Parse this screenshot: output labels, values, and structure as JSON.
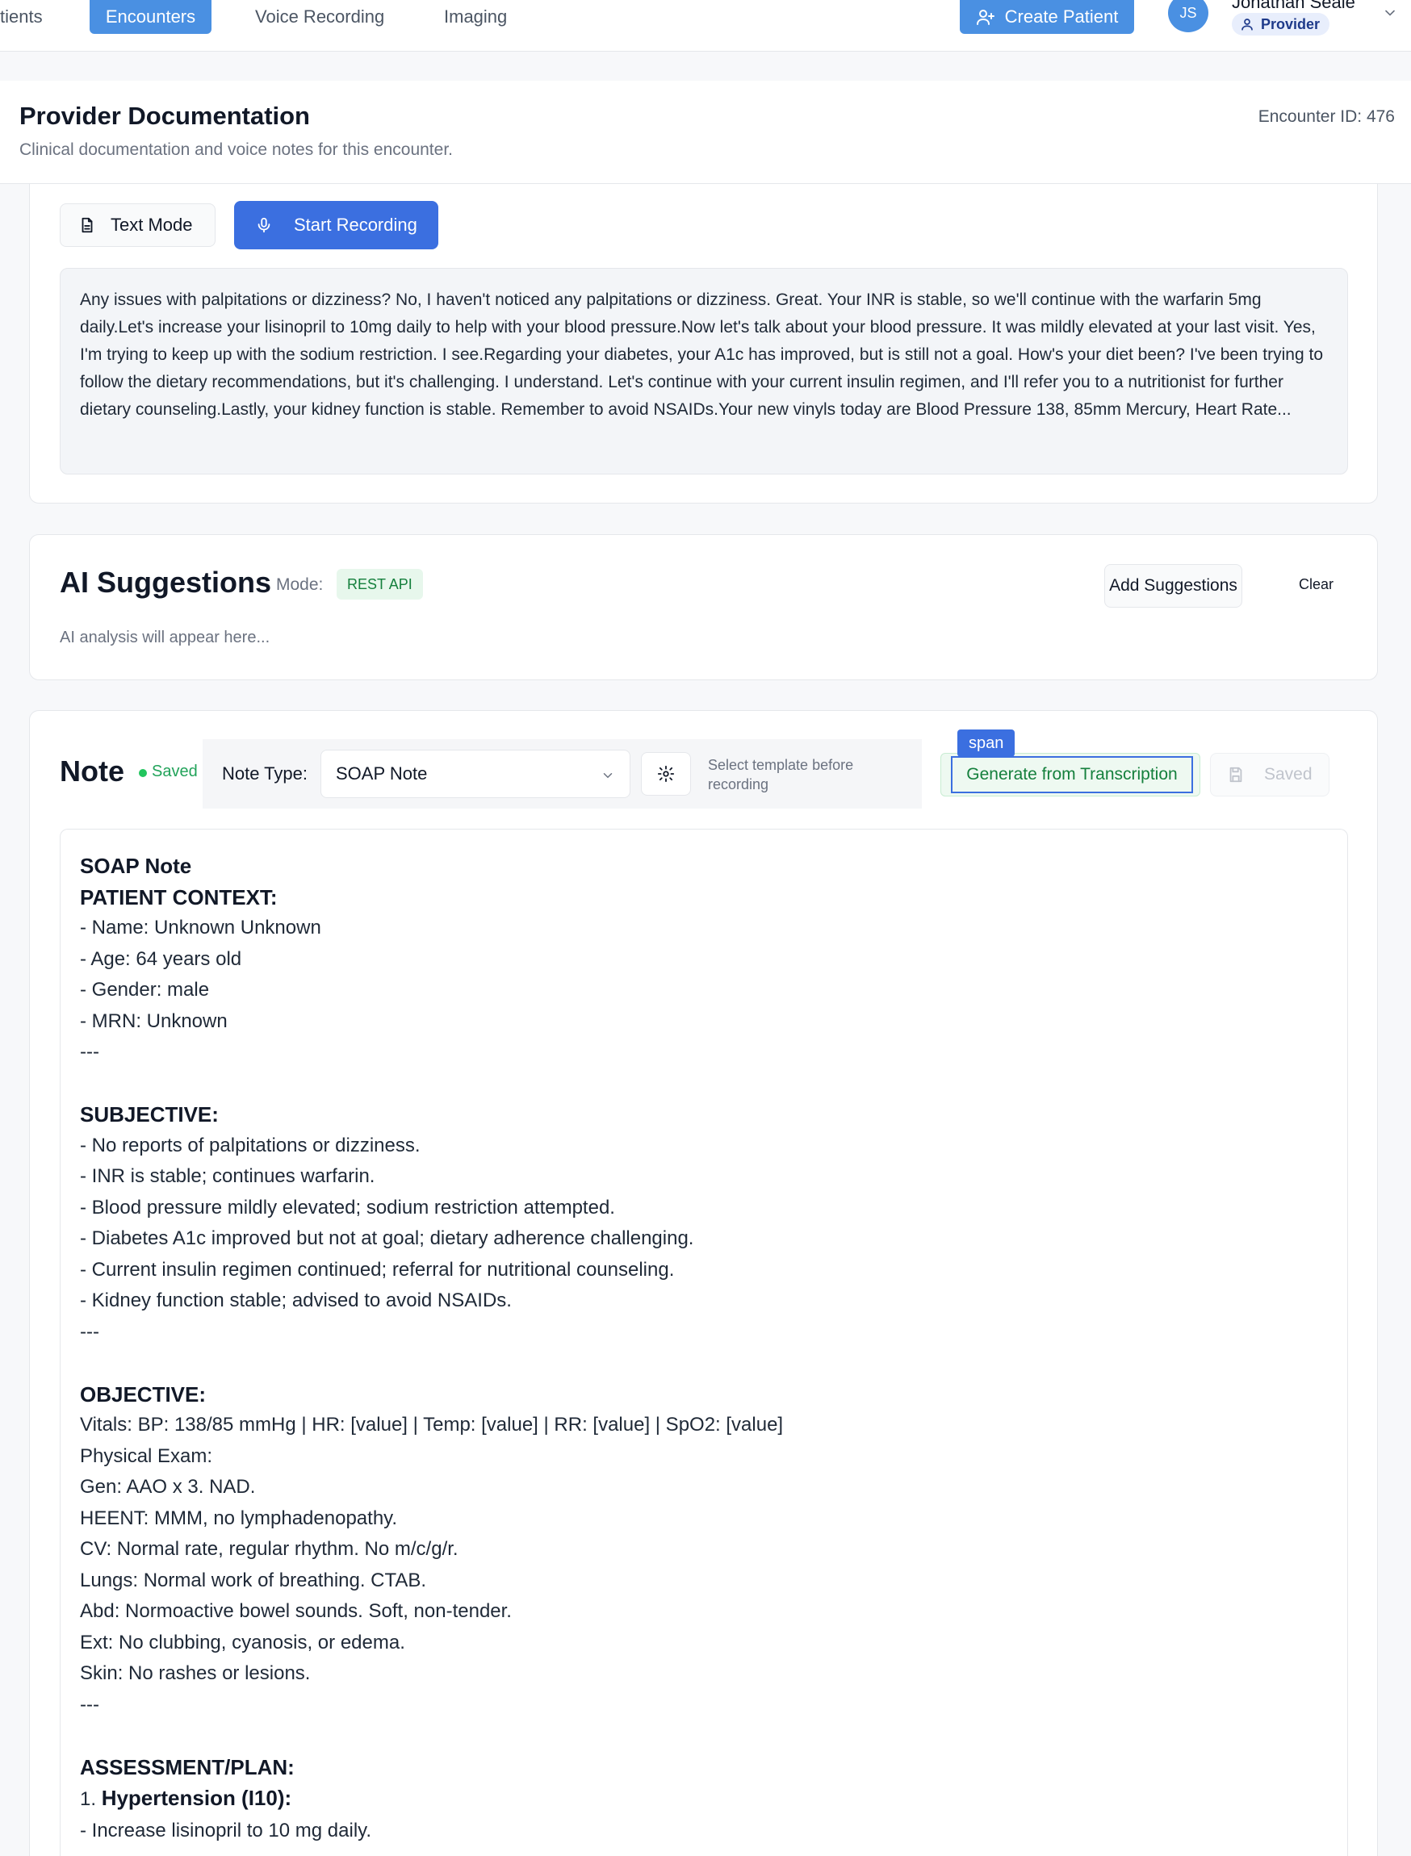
{
  "nav": {
    "tabs": [
      {
        "label": "tients",
        "active": false
      },
      {
        "label": "Encounters",
        "active": true
      },
      {
        "label": "Voice Recording",
        "active": false
      },
      {
        "label": "Imaging",
        "active": false
      }
    ],
    "create_patient": "Create Patient",
    "user": {
      "initials": "JS",
      "name": "Jonathan Seale",
      "role": "Provider"
    }
  },
  "header": {
    "title": "Provider Documentation",
    "subtitle": "Clinical documentation and voice notes for this encounter.",
    "encounter_id": "Encounter ID: 476"
  },
  "voice": {
    "text_mode": "Text Mode",
    "start_recording": "Start Recording",
    "transcript": "Any issues with palpitations or dizziness? No, I haven't noticed any palpitations or dizziness. Great. Your INR is stable, so we'll continue with the warfarin 5mg daily.Let's increase your lisinopril to 10mg daily to help with your blood pressure.Now let's talk about your blood pressure. It was mildly elevated at your last visit. Yes, I'm trying to keep up with the sodium restriction. I see.Regarding your diabetes, your A1c has improved, but is still not a goal. How's your diet been? I've been trying to follow the dietary recommendations, but it's challenging. I understand. Let's continue with your current insulin regimen, and I'll refer you to a nutritionist for further dietary counseling.Lastly, your kidney function is stable. Remember to avoid NSAIDs.Your new vinyls today are Blood Pressure 138, 85mm Mercury, Heart Rate..."
  },
  "ai": {
    "title": "AI Suggestions",
    "mode_label": "Mode:",
    "mode_value": "REST API",
    "add_button": "Add Suggestions",
    "clear_button": "Clear",
    "placeholder": "AI analysis will appear here..."
  },
  "note": {
    "title": "Note",
    "status": "Saved",
    "type_label": "Note Type:",
    "type_value": "SOAP Note",
    "template_hint": "Select template before recording",
    "span_tag": "span",
    "generate_button": "Generate from Transcription",
    "saved_button": "Saved",
    "body": {
      "heading": "SOAP Note",
      "patient_context_heading": "PATIENT CONTEXT:",
      "patient_context": [
        "- Name: Unknown Unknown",
        "- Age: 64 years old",
        "- Gender: male",
        "- MRN: Unknown",
        "---"
      ],
      "subjective_heading": "SUBJECTIVE:",
      "subjective": [
        "- No reports of palpitations or dizziness.",
        "- INR is stable; continues warfarin.",
        "- Blood pressure mildly elevated; sodium restriction attempted.",
        "- Diabetes A1c improved but not at goal; dietary adherence challenging.",
        "- Current insulin regimen continued; referral for nutritional counseling.",
        "- Kidney function stable; advised to avoid NSAIDs.",
        "---"
      ],
      "objective_heading": "OBJECTIVE:",
      "objective": [
        "Vitals: BP: 138/85 mmHg | HR: [value] | Temp: [value] | RR: [value] | SpO2: [value]",
        "Physical Exam:",
        "Gen: AAO x 3. NAD.",
        "HEENT: MMM, no lymphadenopathy.",
        "CV: Normal rate, regular rhythm. No m/c/g/r.",
        "Lungs: Normal work of breathing. CTAB.",
        "Abd: Normoactive bowel sounds. Soft, non-tender.",
        "Ext: No clubbing, cyanosis, or edema.",
        "Skin: No rashes or lesions.",
        "---"
      ],
      "assessment_heading": "ASSESSMENT/PLAN:",
      "problem_number": "1.",
      "problem_title": "Hypertension (I10):",
      "plan": [
        "- Increase lisinopril to 10 mg daily."
      ]
    }
  }
}
